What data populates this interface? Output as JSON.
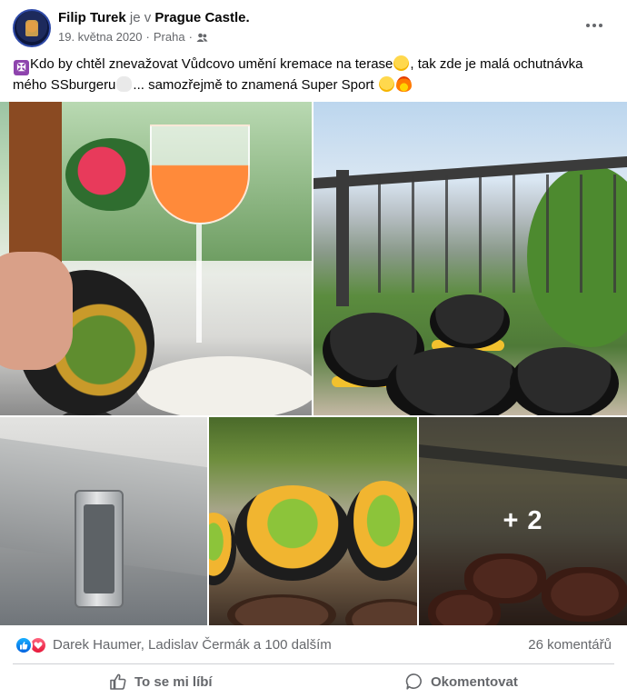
{
  "post": {
    "author": "Filip Turek",
    "connector": "je v",
    "place": "Prague Castle",
    "place_suffix": ".",
    "date": "19. května 2020",
    "dot": "·",
    "location": "Praha",
    "audience_icon": "friends-icon",
    "text_part1": "Kdo by chtěl znevažovat Vůdcovo umění kremace na terase",
    "text_part2": ", tak zde je malá ochutnávka mého SSburgeru",
    "text_part3": "... samozřejmě to znamená Super Sport ",
    "cross_glyph": "✠"
  },
  "gallery": {
    "more_overlay": "+ 2"
  },
  "reactions": {
    "names": "Darek Haumer, Ladislav Čermák a 100 dalším",
    "comments": "26 komentářů"
  },
  "actions": {
    "like_label": "To se mi líbí",
    "comment_label": "Okomentovat"
  },
  "colors": {
    "secondary_text": "#65676b",
    "like_blue": "#0062df",
    "love_red": "#e61739"
  }
}
